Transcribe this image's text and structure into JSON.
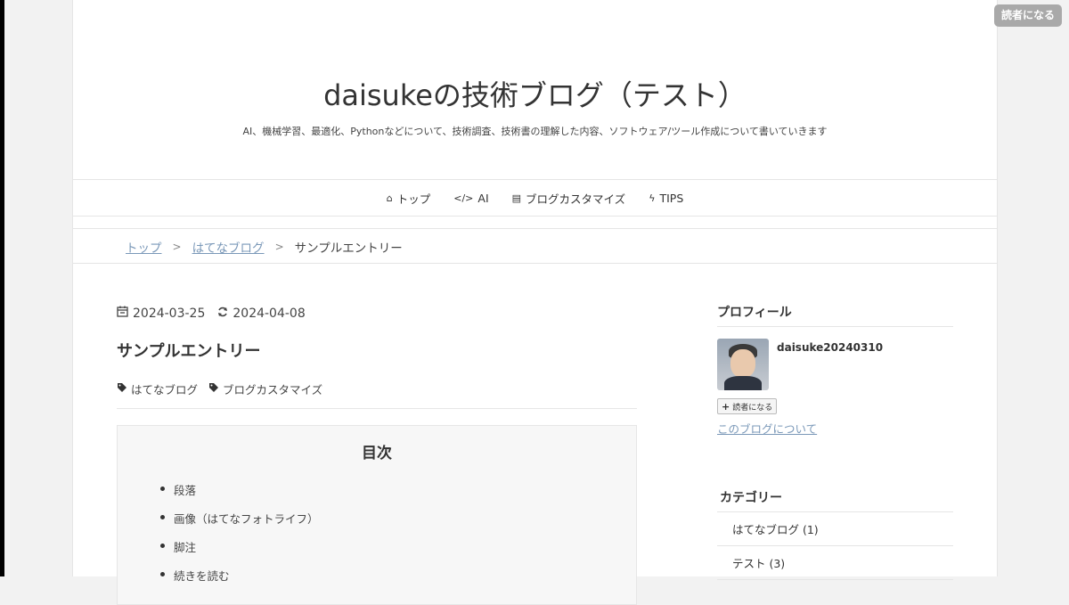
{
  "top_button": "読者になる",
  "header": {
    "title": "daisukeの技術ブログ（テスト）",
    "description": "AI、機械学習、最適化、Pythonなどについて、技術調査、技術書の理解した内容、ソフトウェア/ツール作成について書いていきます"
  },
  "nav": [
    {
      "icon": "home-icon",
      "glyph": "⌂",
      "label": "トップ"
    },
    {
      "icon": "code-icon",
      "glyph": "</>",
      "label": "AI"
    },
    {
      "icon": "document-icon",
      "glyph": "▤",
      "label": "ブログカスタマイズ"
    },
    {
      "icon": "bolt-icon",
      "glyph": "ϟ",
      "label": "TIPS"
    }
  ],
  "breadcrumb": {
    "items": [
      "トップ",
      "はてなブログ"
    ],
    "separator": ">",
    "current": "サンプルエントリー"
  },
  "entry": {
    "date_published": "2024-03-25",
    "date_updated": "2024-04-08",
    "title": "サンプルエントリー",
    "tags": [
      "はてなブログ",
      "ブログカスタマイズ"
    ]
  },
  "toc": {
    "title": "目次",
    "items": [
      "段落",
      "画像（はてなフォトライフ）",
      "脚注",
      "続きを読む"
    ]
  },
  "sidebar": {
    "profile": {
      "heading": "プロフィール",
      "name": "daisuke20240310",
      "reader_button": "読者になる",
      "about_link": "このブログについて"
    },
    "categories": {
      "heading": "カテゴリー",
      "items": [
        "はてなブログ (1)",
        "テスト (3)"
      ]
    }
  },
  "colors": {
    "link": "#7a98b8",
    "top_button_bg": "#a9a9a9"
  }
}
